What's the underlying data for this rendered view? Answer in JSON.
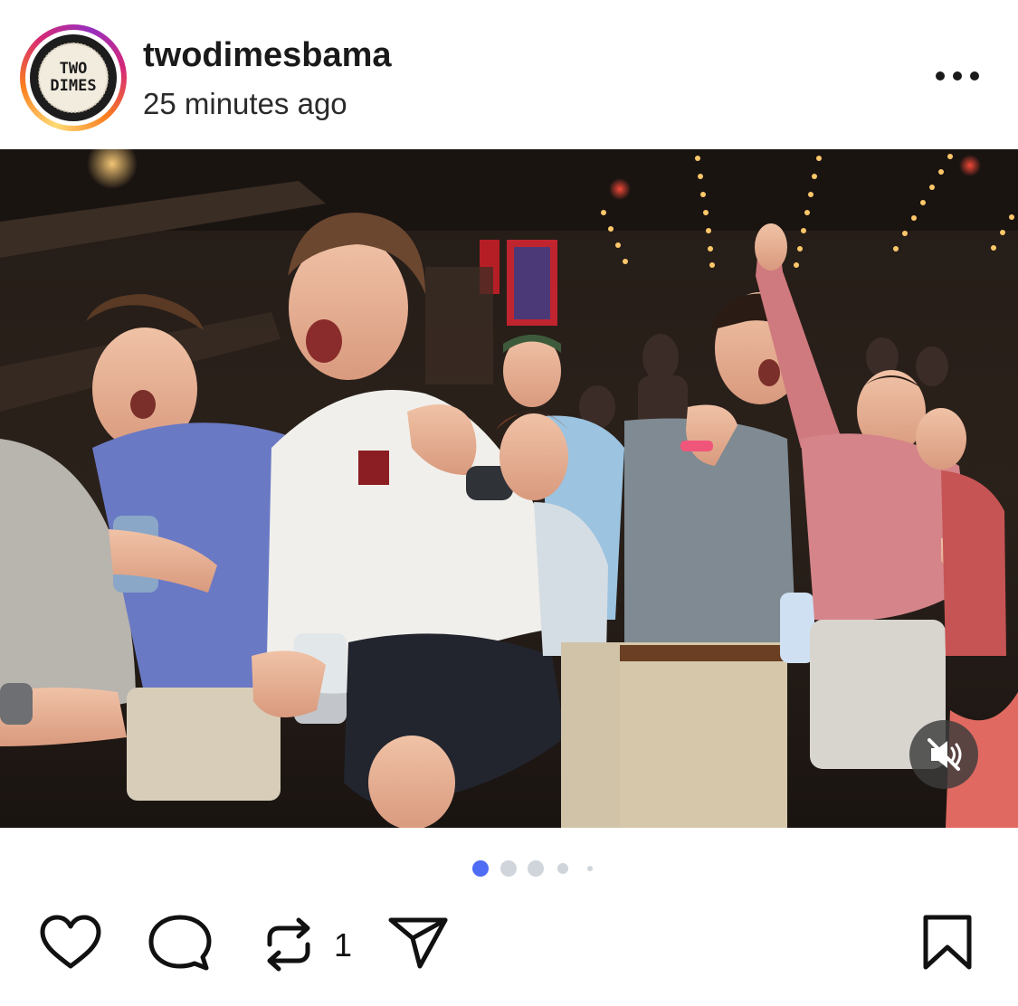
{
  "post": {
    "account": {
      "username": "twodimesbama",
      "avatar_text_line1": "TWO",
      "avatar_text_line2": "DIMES",
      "story_ring": true
    },
    "timestamp": "25 minutes ago",
    "media": {
      "type": "image",
      "alt": "",
      "muted": true
    },
    "carousel": {
      "total_dots": 5,
      "active_index": 0,
      "active_color": "#4f6cf5",
      "inactive_color": "#cfd5db"
    },
    "actions": {
      "like_icon": "heart-icon",
      "comment_icon": "comment-icon",
      "repost_icon": "repost-icon",
      "repost_count": "1",
      "share_icon": "send-icon",
      "save_icon": "bookmark-icon"
    }
  },
  "colors": {
    "text_primary": "#1a1a1a",
    "background": "#ffffff",
    "ring_gradient": [
      "#feda75",
      "#fa7e1e",
      "#d62976",
      "#962fbf"
    ]
  }
}
